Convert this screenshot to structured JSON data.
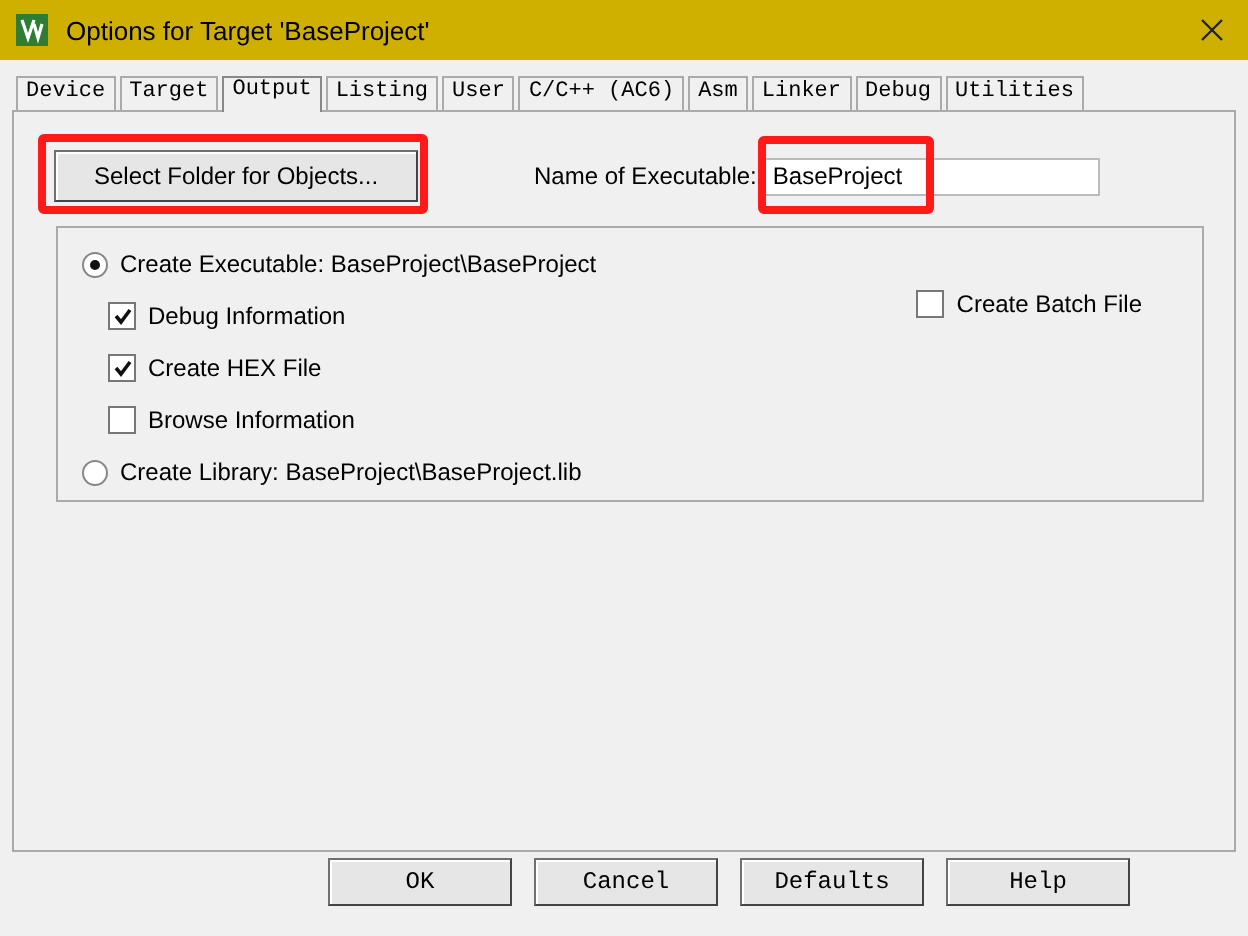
{
  "window": {
    "title": "Options for Target 'BaseProject'"
  },
  "tabs": [
    {
      "label": "Device",
      "selected": false
    },
    {
      "label": "Target",
      "selected": false
    },
    {
      "label": "Output",
      "selected": true
    },
    {
      "label": "Listing",
      "selected": false
    },
    {
      "label": "User",
      "selected": false
    },
    {
      "label": "C/C++ (AC6)",
      "selected": false
    },
    {
      "label": "Asm",
      "selected": false
    },
    {
      "label": "Linker",
      "selected": false
    },
    {
      "label": "Debug",
      "selected": false
    },
    {
      "label": "Utilities",
      "selected": false
    }
  ],
  "select_folder_button": {
    "label": "Select Folder for Objects...",
    "highlighted": true
  },
  "name_of_executable": {
    "label": "Name of Executable:",
    "value": "BaseProject",
    "highlighted": true
  },
  "create_executable": {
    "label": "Create Executable:  BaseProject\\BaseProject",
    "selected": true
  },
  "options": [
    {
      "label": "Debug Information",
      "checked": true
    },
    {
      "label": "Create HEX File",
      "checked": true
    },
    {
      "label": "Browse Information",
      "checked": false
    }
  ],
  "create_batch_file": {
    "label": "Create Batch File",
    "checked": false
  },
  "create_library": {
    "label": "Create Library:  BaseProject\\BaseProject.lib",
    "selected": false
  },
  "buttons": [
    "OK",
    "Cancel",
    "Defaults",
    "Help"
  ]
}
